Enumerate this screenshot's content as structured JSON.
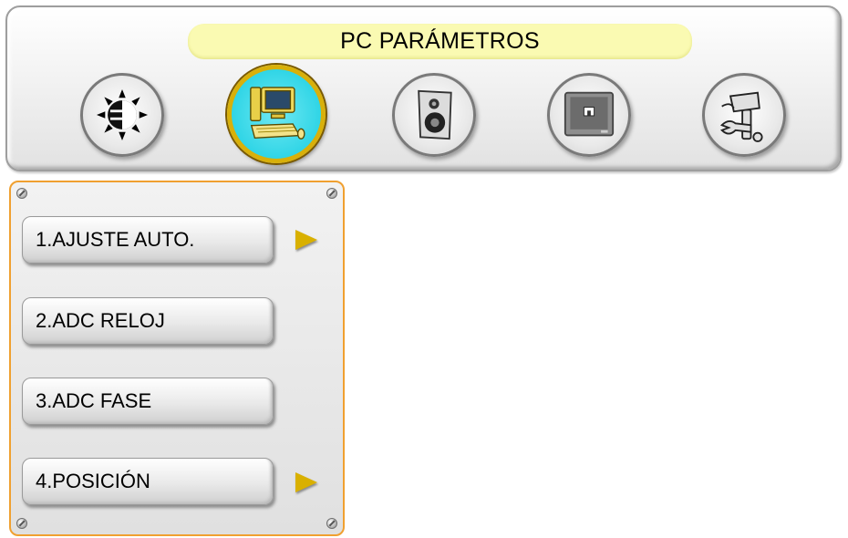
{
  "header": {
    "title": "PC PARÁMETROS"
  },
  "toolbar": {
    "icons": [
      {
        "name": "brightness-icon",
        "active": false
      },
      {
        "name": "pc-computer-icon",
        "active": true
      },
      {
        "name": "speaker-icon",
        "active": false
      },
      {
        "name": "tv-screen-icon",
        "active": false
      },
      {
        "name": "tools-icon",
        "active": false
      }
    ]
  },
  "menu": {
    "items": [
      {
        "label": "1.AJUSTE AUTO.",
        "has_submenu": true
      },
      {
        "label": "2.ADC RELOJ",
        "has_submenu": false
      },
      {
        "label": "3.ADC FASE",
        "has_submenu": false
      },
      {
        "label": "4.POSICIÓN",
        "has_submenu": true
      }
    ]
  },
  "colors": {
    "panel_border": "#f0a030",
    "title_pill": "#fafab2",
    "active_icon_ring": "#d8b00a",
    "active_icon_fill": "#30d5e6",
    "arrow": "#d9b000"
  }
}
